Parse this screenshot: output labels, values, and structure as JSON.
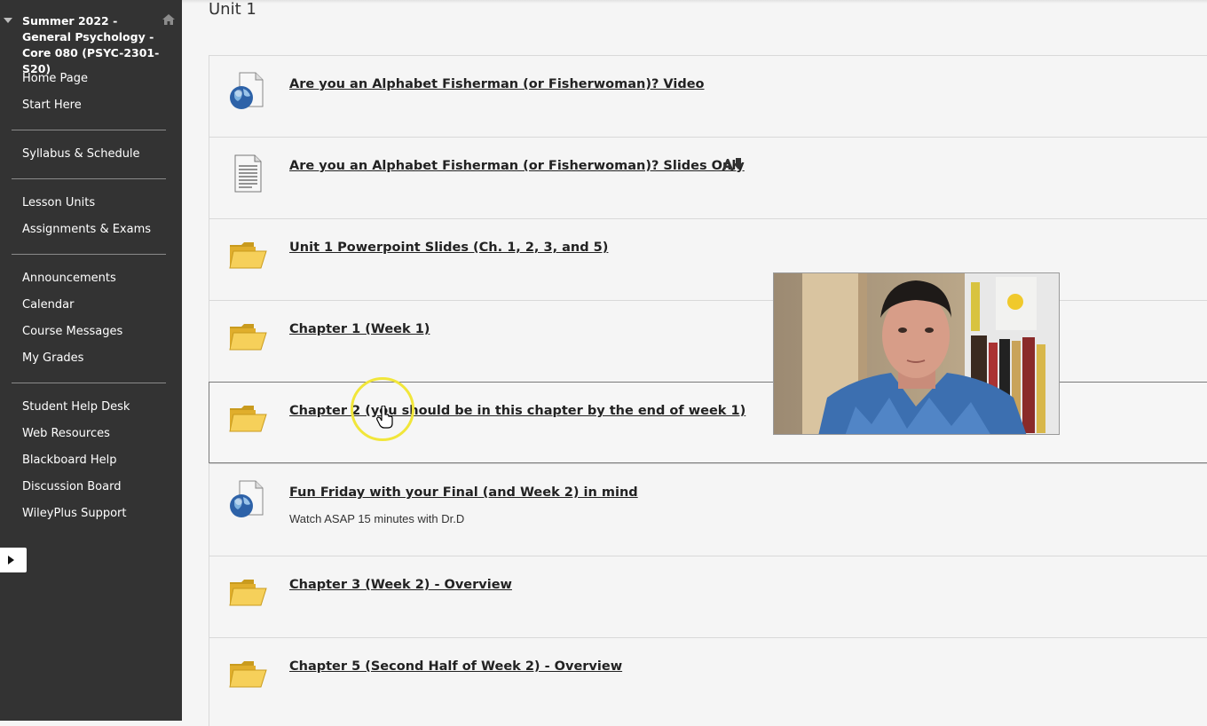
{
  "sidebar": {
    "course_title": "Summer 2022 - General Psychology - Core 080 (PSYC-2301-S20)",
    "groups": [
      [
        "Home Page",
        "Start Here"
      ],
      [
        "Syllabus & Schedule"
      ],
      [
        "Lesson Units",
        "Assignments & Exams"
      ],
      [
        "Announcements",
        "Calendar",
        "Course Messages",
        "My Grades"
      ],
      [
        "Student Help Desk",
        "Web Resources",
        "Blackboard Help",
        "Discussion Board",
        "WileyPlus Support"
      ]
    ]
  },
  "main": {
    "unit_title": "Unit 1",
    "items": [
      {
        "icon": "web-link-icon",
        "title": "Are you an Alphabet Fisherman (or Fisherwoman)? Video",
        "desc": ""
      },
      {
        "icon": "document-icon",
        "title": "Are you an Alphabet Fisherman (or Fisherwoman)? Slides Only",
        "desc": "",
        "has_download": true
      },
      {
        "icon": "folder-icon",
        "title": "Unit 1 Powerpoint Slides (Ch. 1, 2, 3, and 5)",
        "desc": ""
      },
      {
        "icon": "folder-icon",
        "title": "Chapter 1 (Week 1)",
        "desc": ""
      },
      {
        "icon": "folder-icon",
        "title": "Chapter 2 (you should be in this chapter by the end of week 1)",
        "desc": ""
      },
      {
        "icon": "web-link-icon",
        "title": "Fun Friday with your Final (and Week 2) in mind",
        "desc": "Watch ASAP 15 minutes with Dr.D"
      },
      {
        "icon": "folder-icon",
        "title": "Chapter 3 (Week 2) - Overview",
        "desc": ""
      },
      {
        "icon": "folder-icon",
        "title": "Chapter 5 (Second Half of Week 2) - Overview",
        "desc": ""
      }
    ]
  },
  "colors": {
    "sidebar_bg": "#333333",
    "page_bg": "#f5f5f5",
    "cursor_highlight": "#f1e63a"
  }
}
